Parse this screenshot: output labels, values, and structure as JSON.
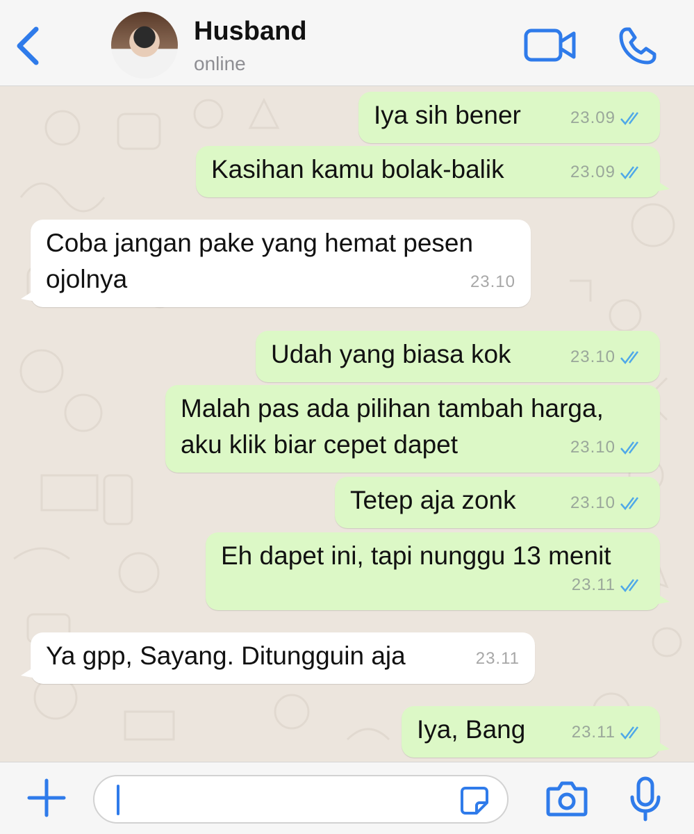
{
  "header": {
    "contact_name": "Husband",
    "status": "online"
  },
  "icons": {
    "back": "chevron-left-icon",
    "video": "video-call-icon",
    "call": "phone-icon",
    "attach": "plus-icon",
    "sticker": "sticker-icon",
    "camera": "camera-icon",
    "mic": "microphone-icon",
    "read_receipt": "double-check-icon"
  },
  "colors": {
    "accent": "#2F7BEA",
    "outgoing_bubble": "#DCF8C6",
    "incoming_bubble": "#FFFFFF",
    "chat_background": "#ECE5DD",
    "read_ticks": "#4FA8E8"
  },
  "messages": [
    {
      "direction": "out",
      "text": "Iya sih bener",
      "time": "23.09",
      "read": true
    },
    {
      "direction": "out",
      "text": "Kasihan kamu bolak-balik",
      "time": "23.09",
      "read": true
    },
    {
      "direction": "in",
      "text": "Coba jangan pake yang hemat pesen\nojolnya",
      "time": "23.10"
    },
    {
      "direction": "out",
      "text": "Udah yang biasa kok",
      "time": "23.10",
      "read": true
    },
    {
      "direction": "out",
      "text": "Malah pas ada pilihan tambah harga,\naku klik biar cepet dapet",
      "time": "23.10",
      "read": true
    },
    {
      "direction": "out",
      "text": "Tetep aja zonk",
      "time": "23.10",
      "read": true
    },
    {
      "direction": "out",
      "text": "Eh dapet ini, tapi nunggu 13 menit",
      "time": "23.11",
      "read": true
    },
    {
      "direction": "in",
      "text": "Ya gpp, Sayang. Ditungguin aja",
      "time": "23.11"
    },
    {
      "direction": "out",
      "text": "Iya, Bang",
      "time": "23.11",
      "read": true
    }
  ],
  "composer": {
    "value": ""
  }
}
